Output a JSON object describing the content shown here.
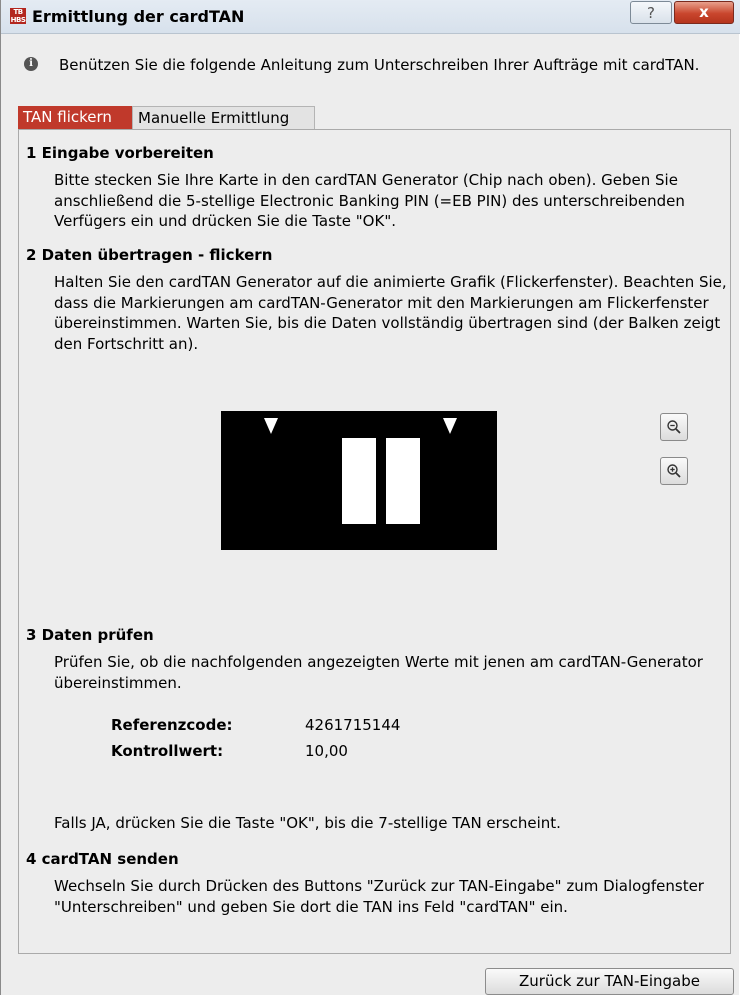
{
  "window": {
    "title": "Ermittlung der cardTAN",
    "app_icon_text": "TB HBS",
    "help_label": "?",
    "close_label": "x"
  },
  "info_text": "Benützen Sie die folgende Anleitung zum Unterschreiben Ihrer Aufträge mit cardTAN.",
  "tabs": [
    {
      "label": "TAN flickern",
      "active": true
    },
    {
      "label": "Manuelle Ermittlung",
      "active": false
    }
  ],
  "sections": [
    {
      "heading": "1 Eingabe vorbereiten",
      "text": "Bitte stecken Sie Ihre Karte in den cardTAN Generator (Chip nach oben). Geben Sie anschließend die 5-stellige Electronic Banking PIN (=EB PIN) des unterschreibenden Verfügers ein und drücken Sie die Taste \"OK\"."
    },
    {
      "heading": "2 Daten übertragen - flickern",
      "text": "Halten Sie den cardTAN Generator auf die animierte Grafik (Flickerfenster). Beachten Sie, dass die Markierungen am cardTAN-Generator mit den Markierungen am Flickerfenster übereinstimmen. Warten Sie, bis die Daten vollständig übertragen sind (der Balken zeigt den Fortschritt an)."
    },
    {
      "heading": "3 Daten prüfen",
      "text": "Prüfen Sie, ob die nachfolgenden angezeigten Werte mit jenen am cardTAN-Generator übereinstimmen.",
      "fields": [
        {
          "label": "Referenzcode:",
          "value": "4261715144"
        },
        {
          "label": "Kontrollwert:",
          "value": "10,00"
        }
      ],
      "note": "Falls JA, drücken Sie die Taste \"OK\", bis die 7-stellige TAN erscheint."
    },
    {
      "heading": "4 cardTAN senden",
      "text": "Wechseln Sie durch Drücken des Buttons \"Zurück zur TAN-Eingabe\" zum Dialogfenster \"Unterschreiben\" und geben Sie dort die TAN ins Feld \"cardTAN\" ein."
    }
  ],
  "zoom_out_icon": "zoom-out-icon",
  "zoom_in_icon": "zoom-in-icon",
  "back_button_label": "Zurück zur TAN-Eingabe"
}
